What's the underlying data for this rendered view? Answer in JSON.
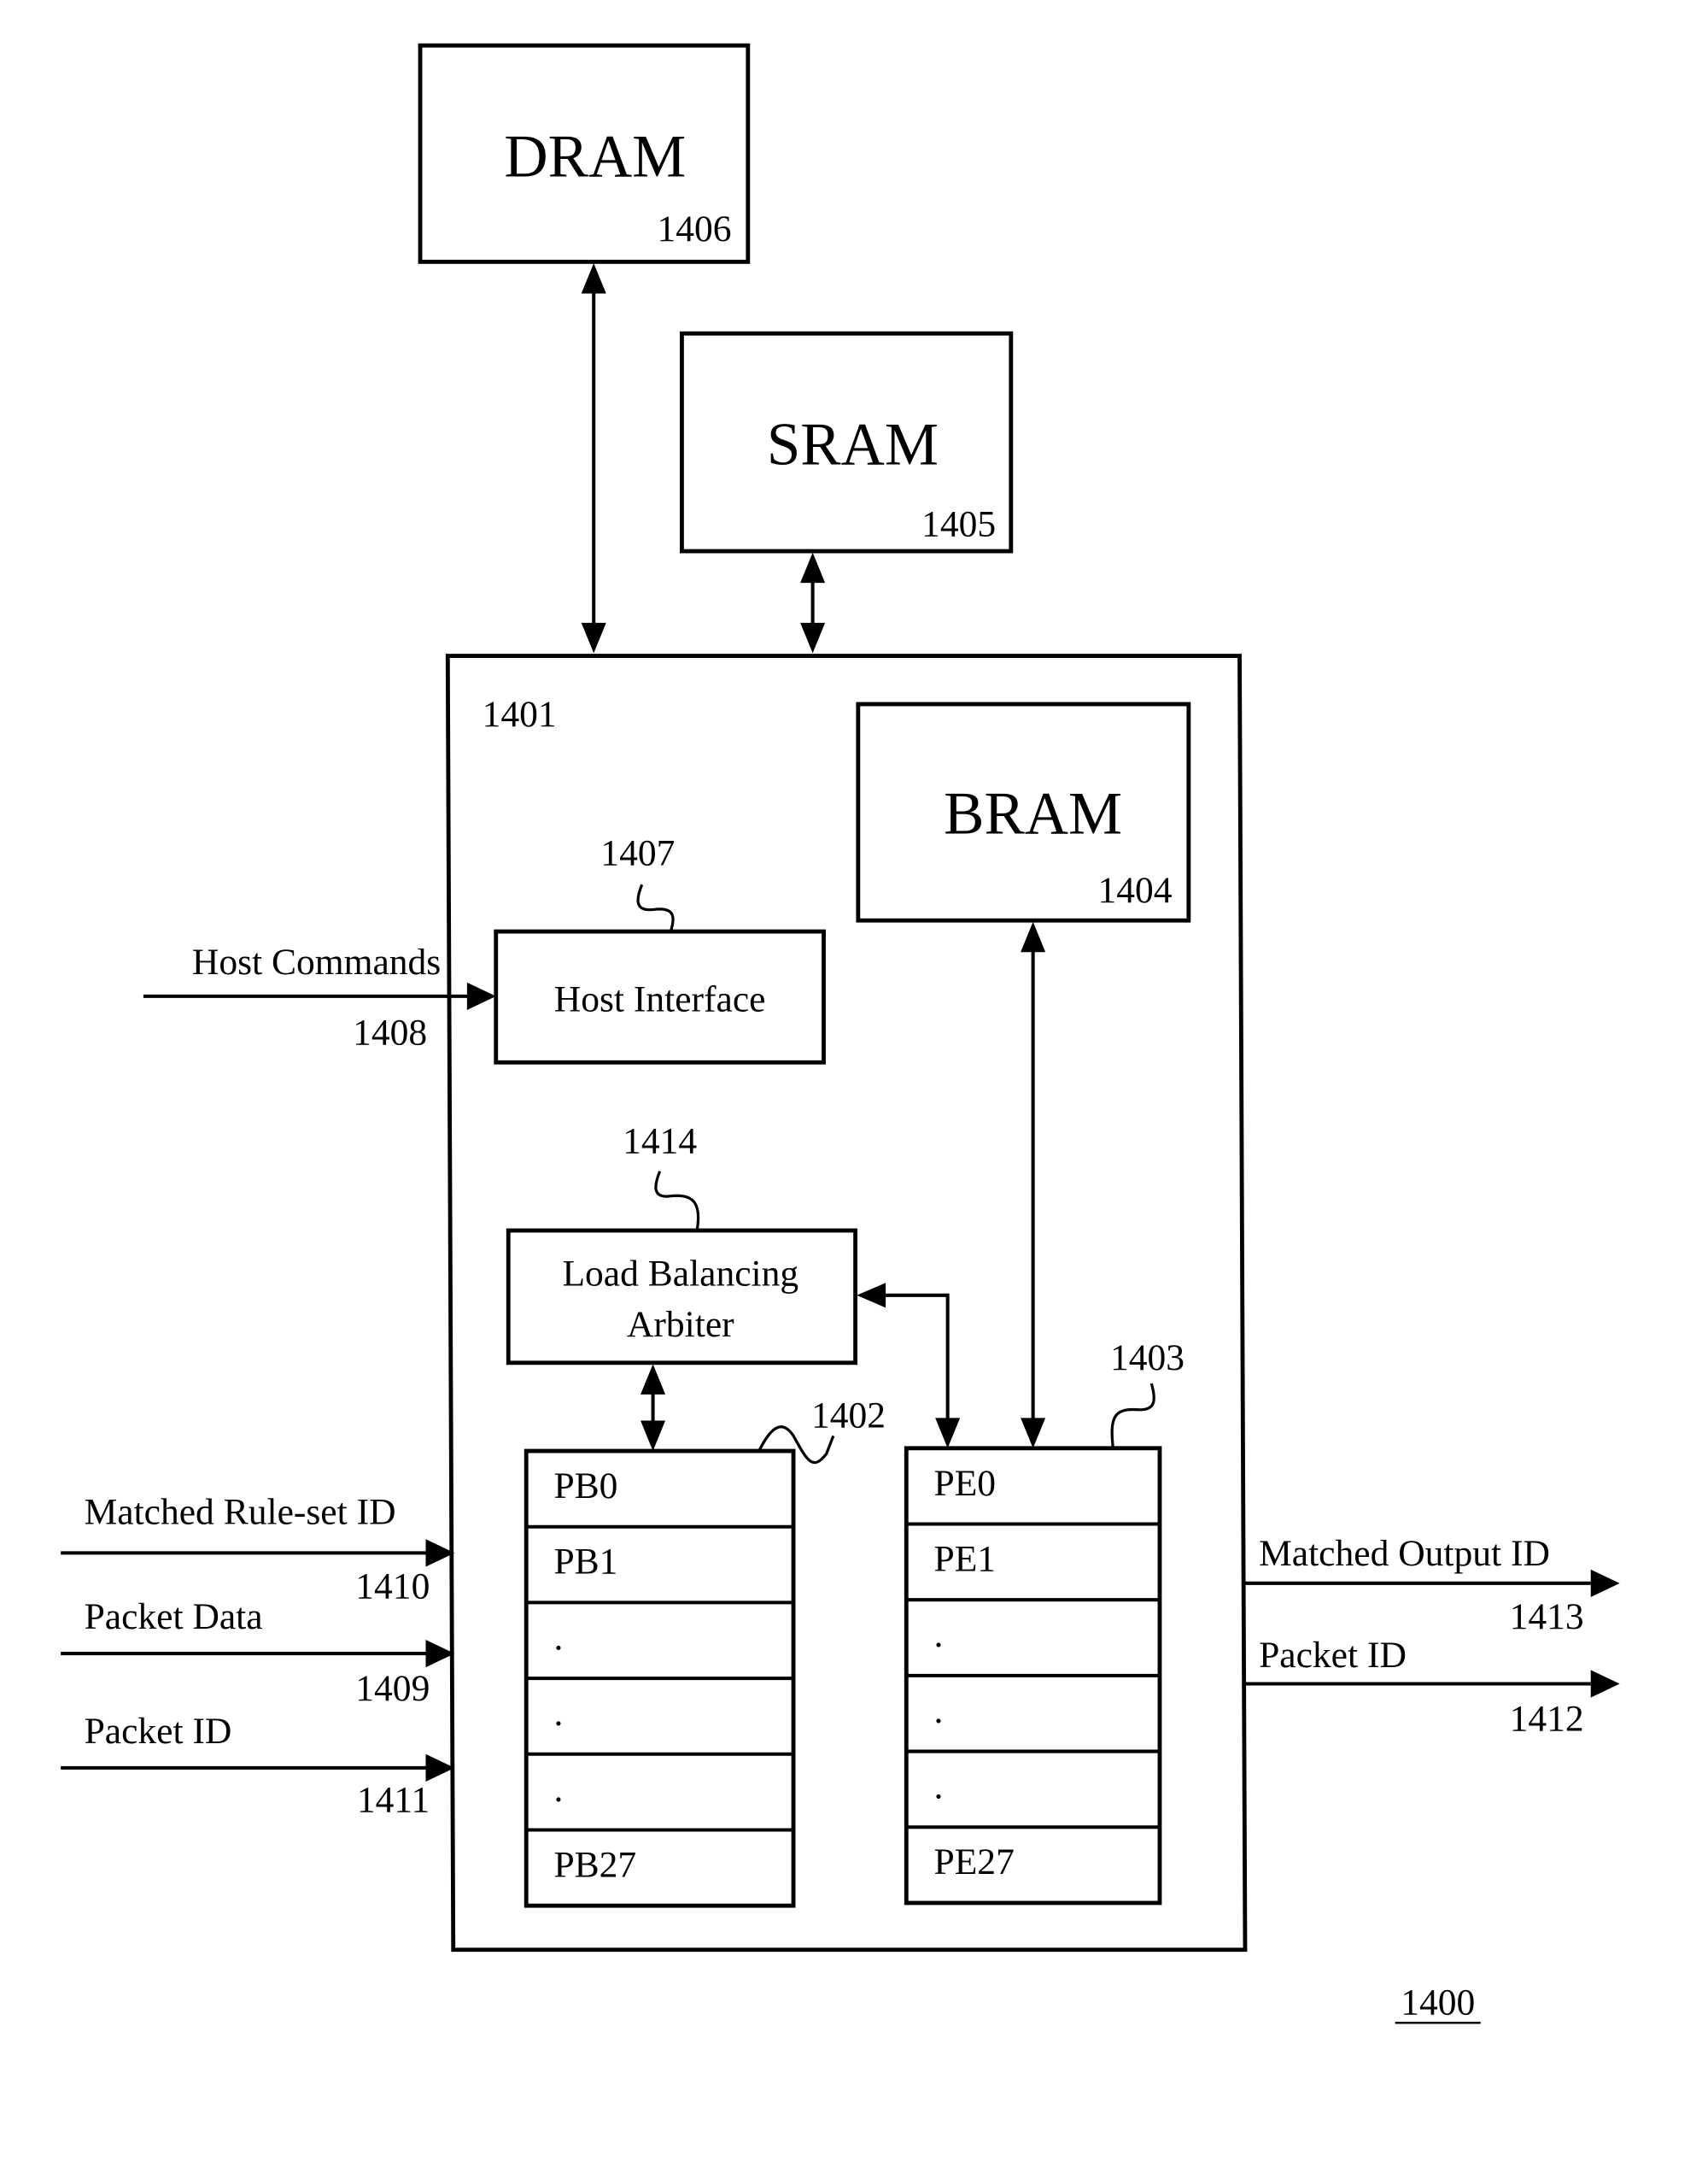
{
  "figure": {
    "number": "1400",
    "blocks": {
      "dram": {
        "label": "DRAM",
        "ref": "1406"
      },
      "sram": {
        "label": "SRAM",
        "ref": "1405"
      },
      "chip": {
        "ref": "1401"
      },
      "bram": {
        "label": "BRAM",
        "ref": "1404"
      },
      "host_interface": {
        "label": "Host Interface",
        "ref": "1407"
      },
      "arbiter": {
        "label_line1": "Load Balancing",
        "label_line2": "Arbiter",
        "ref": "1414"
      },
      "packet_buffers": {
        "ref": "1402",
        "cells": [
          "PB0",
          "PB1",
          ".",
          ".",
          ".",
          "PB27"
        ]
      },
      "processing_engines": {
        "ref": "1403",
        "cells": [
          "PE0",
          "PE1",
          ".",
          ".",
          ".",
          "PE27"
        ]
      }
    },
    "inputs": [
      {
        "label": "Host Commands",
        "ref": "1408"
      },
      {
        "label": "Matched Rule-set ID",
        "ref": "1410"
      },
      {
        "label": "Packet Data",
        "ref": "1409"
      },
      {
        "label": "Packet ID",
        "ref": "1411"
      }
    ],
    "outputs": [
      {
        "label": "Matched Output ID",
        "ref": "1413"
      },
      {
        "label": "Packet ID",
        "ref": "1412"
      }
    ]
  }
}
